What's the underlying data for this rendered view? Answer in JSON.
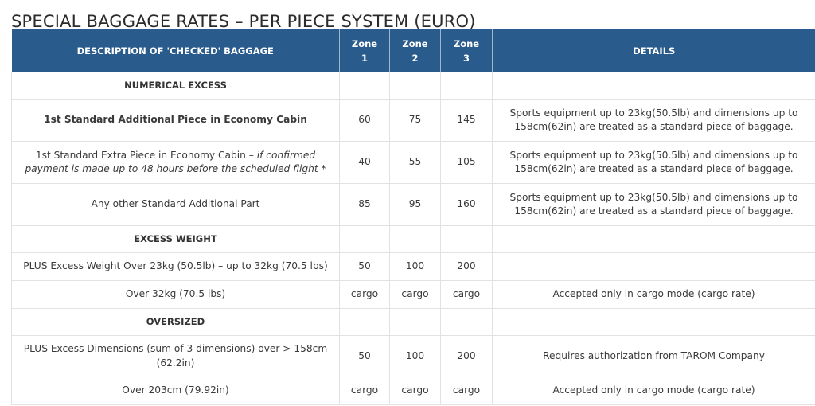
{
  "page": {
    "title": "SPECIAL BAGGAGE RATES – PER PIECE SYSTEM (EURO)"
  },
  "table": {
    "headers": {
      "description": "DESCRIPTION OF 'CHECKED' BAGGAGE",
      "zone1_line1": "Zone",
      "zone1_line2": "1",
      "zone2_line1": "Zone",
      "zone2_line2": "2",
      "zone3_line1": "Zone",
      "zone3_line2": "3",
      "details": "DETAILS"
    },
    "sections": {
      "numerical_excess": "NUMERICAL EXCESS",
      "excess_weight": "EXCESS WEIGHT",
      "oversized": "OVERSIZED"
    },
    "rows": [
      {
        "description": "1st Standard Additional Piece in Economy Cabin",
        "zone1": "60",
        "zone2": "75",
        "zone3": "145",
        "details": "Sports equipment up to 23kg(50.5lb) and dimensions up to 158cm(62in) are treated as a standard piece of baggage."
      },
      {
        "description": "1st Standard Extra Piece in Economy Cabin – ",
        "description_italic": "if confirmed payment is made up to 48 hours before the scheduled flight",
        "description_suffix": " *",
        "zone1": "40",
        "zone2": "55",
        "zone3": "105",
        "details": "Sports equipment up to 23kg(50.5lb) and dimensions up to 158cm(62in) are treated as a standard piece of baggage."
      },
      {
        "description": "Any other Standard Additional Part",
        "zone1": "85",
        "zone2": "95",
        "zone3": "160",
        "details": "Sports equipment up to 23kg(50.5lb) and dimensions up to 158cm(62in) are treated as a standard piece of baggage."
      },
      {
        "description": "PLUS Excess Weight Over 23kg (50.5lb) – up to 32kg (70.5 lbs)",
        "zone1": "50",
        "zone2": "100",
        "zone3": "200",
        "details": ""
      },
      {
        "description": "Over 32kg (70.5 lbs)",
        "zone1": "cargo",
        "zone2": "cargo",
        "zone3": "cargo",
        "details": "Accepted only in cargo mode (cargo rate)"
      },
      {
        "description": "PLUS Excess Dimensions (sum of 3 dimensions) over > 158cm (62.2in)",
        "zone1": "50",
        "zone2": "100",
        "zone3": "200",
        "details": "Requires authorization from TAROM Company"
      },
      {
        "description": "Over 203cm (79.92in)",
        "zone1": "cargo",
        "zone2": "cargo",
        "zone3": "cargo",
        "details": "Accepted only in cargo mode (cargo rate)"
      }
    ]
  },
  "colors": {
    "header_bg": "#295b8c",
    "header_text": "#ffffff",
    "grid": "#e2e2e2"
  }
}
